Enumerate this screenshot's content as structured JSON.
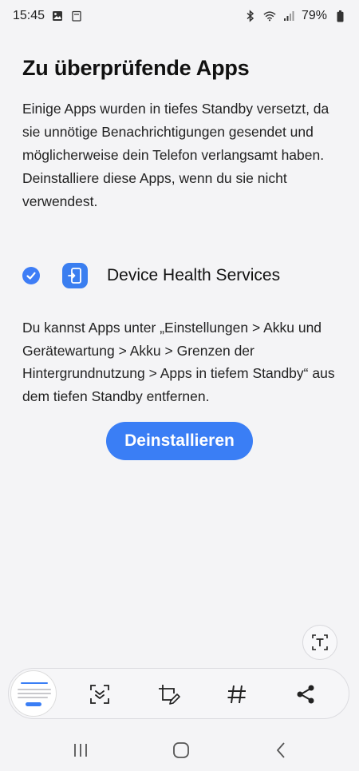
{
  "status": {
    "time": "15:45",
    "battery": "79%"
  },
  "title": "Zu überprüfende Apps",
  "intro": {
    "p1": "Einige Apps wurden in tiefes Standby versetzt, da sie unnötige Benachrichtigungen gesendet und möglicherweise dein Telefon verlangsamt haben.",
    "p2": "Deinstalliere diese Apps, wenn du sie nicht verwendest."
  },
  "apps": [
    {
      "name": "Device Health Services",
      "checked": true
    }
  ],
  "info": "Du kannst Apps unter „Einstellungen > Akku und Gerätewartung > Akku > Grenzen der Hintergrundnutzung > Apps in tiefem Standby“ aus dem tiefen Standby entfernen.",
  "primary_button": "Deinstallieren",
  "toolbar": {
    "icons": [
      "screenshot-thumbnail",
      "scroll-capture-icon",
      "draw-crop-icon",
      "tag-icon",
      "share-icon"
    ]
  },
  "colors": {
    "accent": "#3a7ef5",
    "background": "#f4f4f6"
  }
}
